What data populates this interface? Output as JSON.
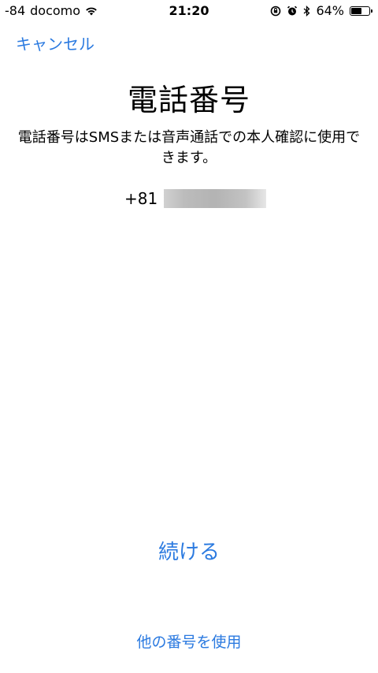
{
  "status_bar": {
    "signal": "-84",
    "carrier": "docomo",
    "time": "21:20",
    "battery_text": "64%",
    "battery_level": 0.64,
    "icons": [
      "wifi-icon",
      "rotation-lock-icon",
      "alarm-icon",
      "bluetooth-icon",
      "battery-icon"
    ]
  },
  "nav": {
    "cancel_label": "キャンセル"
  },
  "main": {
    "title": "電話番号",
    "description": "電話番号はSMSまたは音声通話での本人確認に使用できます。",
    "country_code": "+81"
  },
  "actions": {
    "continue_label": "続ける",
    "other_number_label": "他の番号を使用"
  },
  "colors": {
    "accent": "#2b7ae0",
    "background": "#ffffff",
    "text": "#000000"
  }
}
